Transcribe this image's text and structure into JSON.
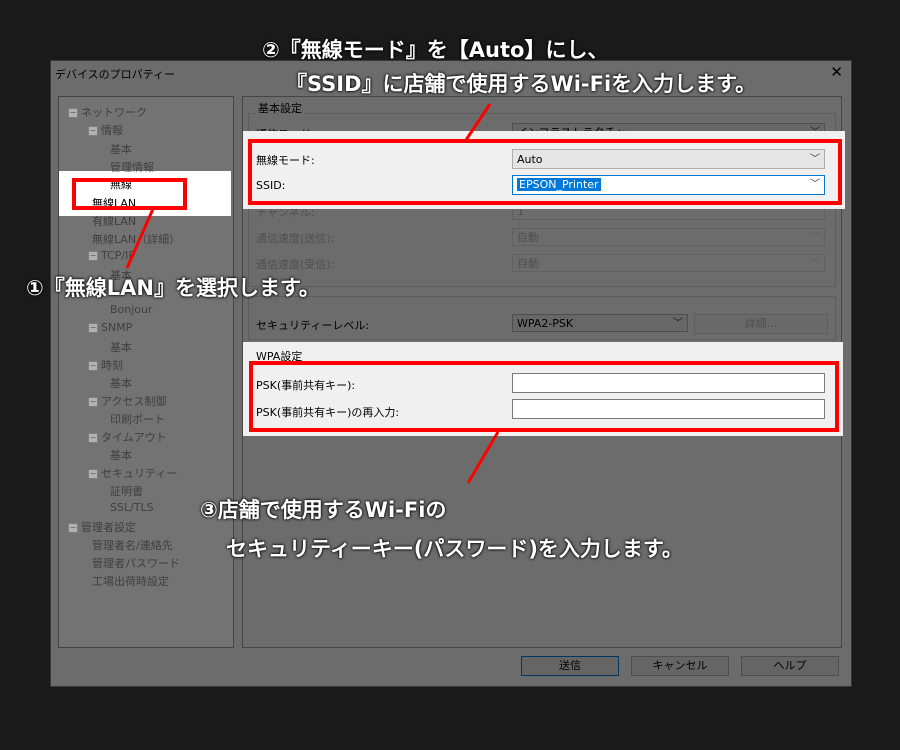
{
  "dialog": {
    "title": "デバイスのプロパティー",
    "close_label": "✕"
  },
  "tree": {
    "items": [
      {
        "label": "ネットワーク",
        "expander": "−"
      },
      {
        "label": "情報",
        "expander": "−"
      },
      {
        "label": "基本"
      },
      {
        "label": "管理情報"
      },
      {
        "label": "無線"
      },
      {
        "label": "無線LAN"
      },
      {
        "label": "有線LAN"
      },
      {
        "label": "無線LAN（詳細）"
      },
      {
        "label": "TCP/IP",
        "expander": "−"
      },
      {
        "label": "基本"
      },
      {
        "label": "Bonjour"
      },
      {
        "label": "SNMP",
        "expander": "−"
      },
      {
        "label": "基本"
      },
      {
        "label": "時刻",
        "expander": "−"
      },
      {
        "label": "基本"
      },
      {
        "label": "アクセス制御",
        "expander": "−"
      },
      {
        "label": "印刷ポート"
      },
      {
        "label": "タイムアウト",
        "expander": "−"
      },
      {
        "label": "基本"
      },
      {
        "label": "セキュリティー",
        "expander": "−"
      },
      {
        "label": "証明書"
      },
      {
        "label": "SSL/TLS"
      },
      {
        "label": "管理者設定",
        "expander": "−"
      },
      {
        "label": "管理者名/連絡先"
      },
      {
        "label": "管理者パスワード"
      },
      {
        "label": "工場出荷時設定"
      }
    ]
  },
  "basic": {
    "group_label": "基本設定",
    "comm_mode_label": "通信モード:",
    "comm_mode_value": "インフラストラクチャー",
    "wireless_mode_label": "無線モード:",
    "wireless_mode_value": "Auto",
    "ssid_label": "SSID:",
    "ssid_value": "EPSON_Printer",
    "channel_label": "チャンネル:",
    "channel_value": "1",
    "tx_speed_label": "通信速度(送信):",
    "tx_speed_value": "自動",
    "rx_speed_label": "通信速度(受信):",
    "rx_speed_value": "自動"
  },
  "security": {
    "level_label": "セキュリティーレベル:",
    "level_value": "WPA2-PSK",
    "detail_button": "詳細..."
  },
  "wpa": {
    "group_label": "WPA設定",
    "psk_label": "PSK(事前共有キー):",
    "psk_confirm_label": "PSK(事前共有キー)の再入力:",
    "psk_value": "",
    "psk_confirm_value": ""
  },
  "buttons": {
    "send": "送信",
    "cancel": "キャンセル",
    "help": "ヘルプ"
  },
  "annotations": {
    "step1": "①『無線LAN』を選択します。",
    "step2_line1": "②『無線モード』を【Auto】にし、",
    "step2_line2": "『SSID』に店舗で使用するWi-Fiを入力します。",
    "step3_line1": "③店舗で使用するWi-Fiの",
    "step3_line2": "セキュリティーキー(パスワード)を入力します。"
  },
  "colors": {
    "highlight_red": "#ff0000",
    "overlay": "rgba(0,0,0,0.55)",
    "selection_blue": "#0078d7"
  }
}
